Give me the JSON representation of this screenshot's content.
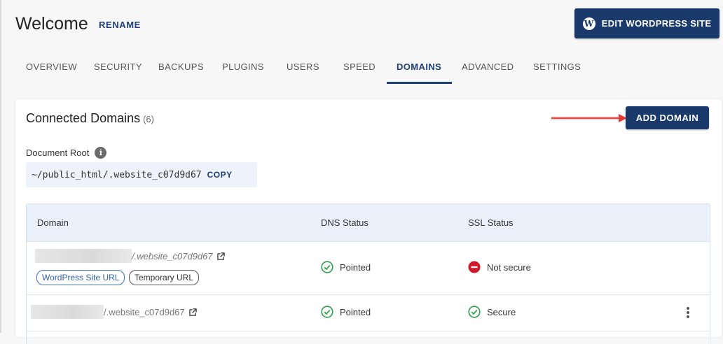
{
  "header": {
    "title": "Welcome",
    "rename_label": "RENAME",
    "edit_wp_label": "EDIT WORDPRESS SITE",
    "edit_wp_icon": "wordpress-icon"
  },
  "tabs": [
    {
      "label": "OVERVIEW",
      "active": false
    },
    {
      "label": "SECURITY",
      "active": false
    },
    {
      "label": "BACKUPS",
      "active": false
    },
    {
      "label": "PLUGINS",
      "active": false
    },
    {
      "label": "USERS",
      "active": false
    },
    {
      "label": "SPEED",
      "active": false
    },
    {
      "label": "DOMAINS",
      "active": true
    },
    {
      "label": "ADVANCED",
      "active": false
    },
    {
      "label": "SETTINGS",
      "active": false
    }
  ],
  "card": {
    "title": "Connected Domains",
    "count": "(6)",
    "add_domain_label": "ADD DOMAIN",
    "document_root_label": "Document Root",
    "document_root_path": "~/public_html/.website_c07d9d67",
    "copy_label": "COPY"
  },
  "table": {
    "headers": {
      "domain": "Domain",
      "dns": "DNS Status",
      "ssl": "SSL Status"
    },
    "rows": [
      {
        "domain_suffix": "/.website_c07d9d67",
        "tags": [
          "WordPress Site URL",
          "Temporary URL"
        ],
        "dns_status": "Pointed",
        "ssl_status": "Not secure"
      },
      {
        "domain_suffix": "/.website_c07d9d67",
        "tags": [],
        "dns_status": "Pointed",
        "ssl_status": "Secure"
      }
    ]
  },
  "colors": {
    "primary": "#1b3a6c",
    "link": "#1f3f76",
    "success": "#2e9e48",
    "danger": "#d0182a",
    "table_header_bg": "#eaf1fb",
    "arrow": "#e53935"
  }
}
